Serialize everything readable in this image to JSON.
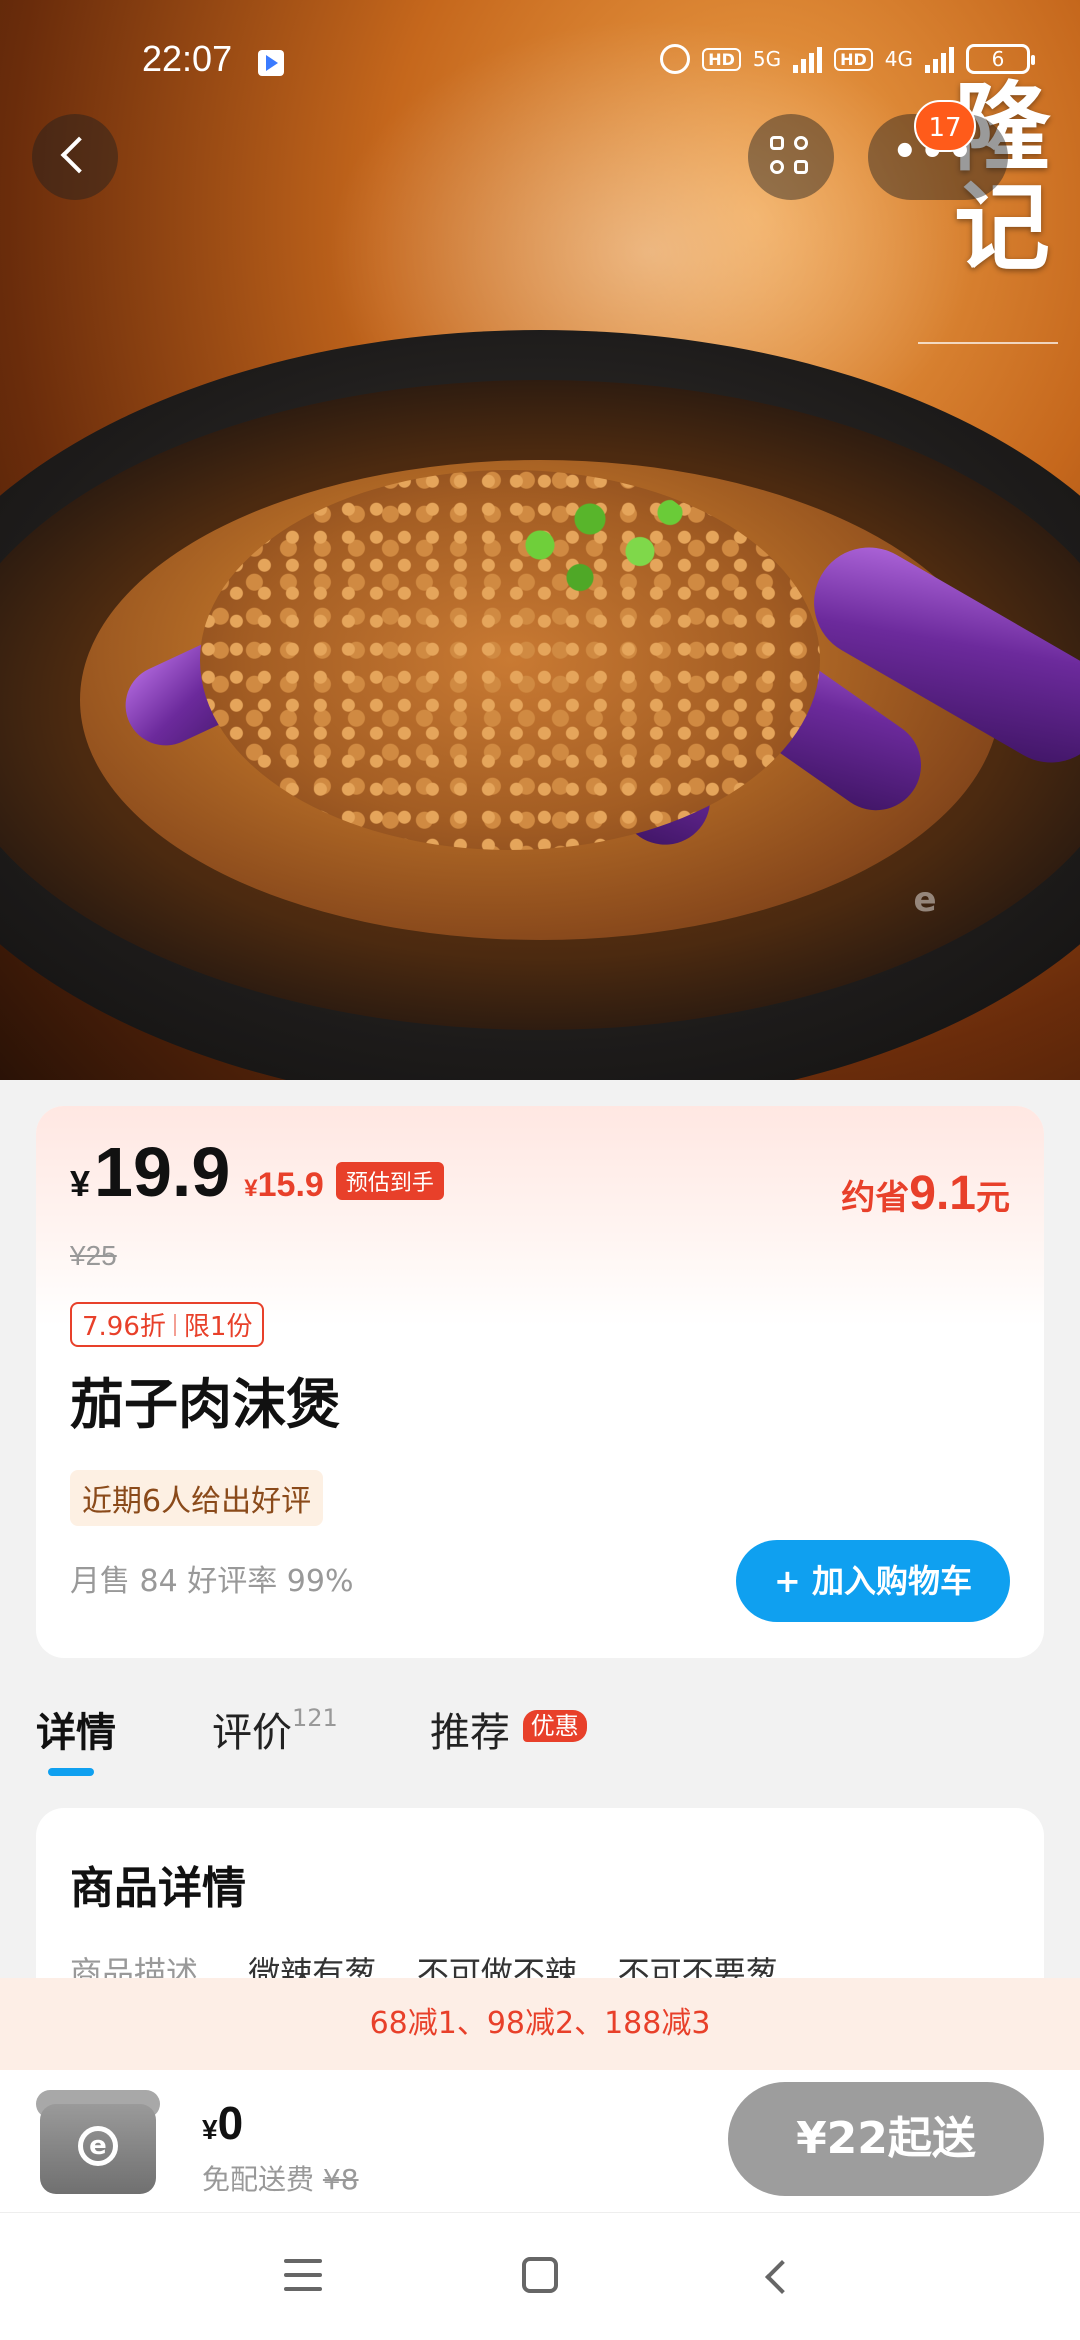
{
  "status_bar": {
    "time": "22:07",
    "network_5g": "5G",
    "network_4g": "4G",
    "hd1": "HD",
    "hd2": "HD",
    "battery": "6"
  },
  "header": {
    "notification_count": "17",
    "logo_text": "隆记"
  },
  "product": {
    "price_symbol": "¥",
    "price": "19.9",
    "discount_price_symbol": "¥",
    "discount_price": "15.9",
    "estimate_tag": "预估到手",
    "save_prefix": "约省",
    "save_amount": "9.1",
    "save_unit": "元",
    "original_price": "¥25",
    "discount_rate": "7.96折",
    "limit": "限1份",
    "name": "茄子肉沫煲",
    "review_tag": "近期6人给出好评",
    "sales": "月售 84 好评率 99%",
    "add_to_cart": "+ 加入购物车"
  },
  "tabs": {
    "detail": "详情",
    "review": "评价",
    "review_count": "121",
    "recommend": "推荐",
    "recommend_badge": "优惠"
  },
  "detail": {
    "title": "商品详情",
    "desc_label": "商品描述",
    "desc_1": "微辣有葱",
    "desc_2": "不可做不辣",
    "desc_3": "不可不要葱"
  },
  "promo": {
    "text": "68减1、98减2、188减3"
  },
  "cart": {
    "price_symbol": "¥",
    "total": "0",
    "delivery_label": "免配送费",
    "delivery_orig": "¥8",
    "min_order": "¥22起送"
  },
  "colors": {
    "accent_blue": "#0fa0f0",
    "price_red": "#e8402a",
    "promo_bg": "#fdeee6"
  }
}
